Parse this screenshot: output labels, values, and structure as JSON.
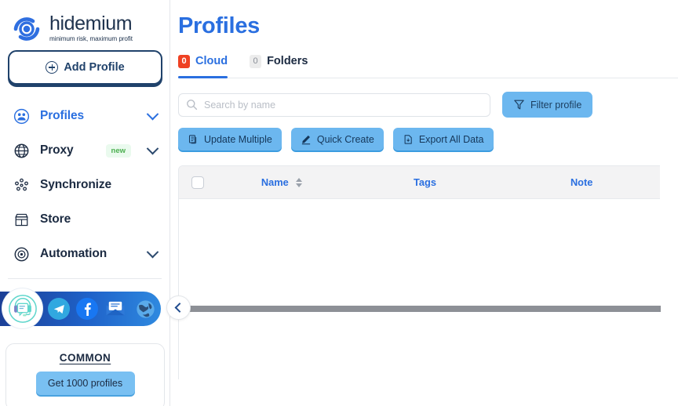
{
  "brand": {
    "name": "hidemium",
    "tagline": "minimum risk, maximum profit",
    "logo_icon": "eye-logo-icon",
    "accent_blue": "#2a6fe0",
    "navy": "#20426b"
  },
  "sidebar": {
    "add_profile": {
      "label": "Add Profile",
      "icon": "plus-circle-icon"
    },
    "items": [
      {
        "label": "Profiles",
        "icon": "people-circle-icon",
        "active": true,
        "chevron": true,
        "badge": ""
      },
      {
        "label": "Proxy",
        "icon": "globe-grid-icon",
        "active": false,
        "chevron": true,
        "badge": "new"
      },
      {
        "label": "Synchronize",
        "icon": "network-nodes-icon",
        "active": false,
        "chevron": false,
        "badge": ""
      },
      {
        "label": "Store",
        "icon": "storefront-icon",
        "active": false,
        "chevron": false,
        "badge": ""
      },
      {
        "label": "Automation",
        "icon": "target-play-icon",
        "active": false,
        "chevron": true,
        "badge": ""
      }
    ],
    "social": [
      {
        "name": "support-headset-icon"
      },
      {
        "name": "telegram-icon"
      },
      {
        "name": "facebook-icon"
      },
      {
        "name": "email-icon"
      },
      {
        "name": "globe-icon"
      }
    ],
    "collapse_icon": "chevron-left-icon",
    "promo": {
      "title": "COMMON",
      "button_label": "Get 1000 profiles"
    }
  },
  "main": {
    "page_title": "Profiles",
    "tabs": [
      {
        "label": "Cloud",
        "count": "0",
        "active": true
      },
      {
        "label": "Folders",
        "count": "0",
        "active": false
      }
    ],
    "search": {
      "placeholder": "Search by name",
      "value": "",
      "icon": "search-icon"
    },
    "filter_button": {
      "label": "Filter profile",
      "icon": "funnel-icon"
    },
    "actions": [
      {
        "label": "Update Multiple",
        "icon": "document-copy-icon"
      },
      {
        "label": "Quick Create",
        "icon": "pencil-icon"
      },
      {
        "label": "Export All Data",
        "icon": "document-download-icon"
      }
    ],
    "table": {
      "select_all_checkbox": "",
      "columns": [
        {
          "label": "Name",
          "sortable": true
        },
        {
          "label": "Tags",
          "sortable": false
        },
        {
          "label": "Note",
          "sortable": false
        }
      ],
      "rows": []
    }
  }
}
